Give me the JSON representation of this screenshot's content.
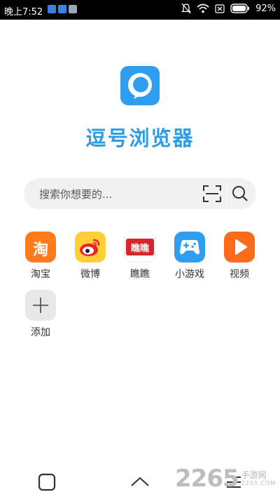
{
  "status_bar": {
    "time": "晚上7:52",
    "battery": "92%",
    "icons": [
      "shield-notification-icon",
      "sync-notification-icon",
      "storage-notification-icon",
      "bell-muted-icon",
      "wifi-icon",
      "sim-card-icon",
      "battery-icon"
    ]
  },
  "app": {
    "title": "逗号浏览器",
    "accent_color": "#2b9ee6"
  },
  "search": {
    "placeholder": "搜索你想要的..."
  },
  "shortcuts": [
    {
      "label": "淘宝",
      "icon": "taobao-icon",
      "color": "#ff7a1a",
      "glyph": "淘"
    },
    {
      "label": "微博",
      "icon": "weibo-icon",
      "color": "#ffcf3a"
    },
    {
      "label": "瞧瞧",
      "icon": "qiaoqiao-icon",
      "color": "#d7262b",
      "glyph": "瞧瞧"
    },
    {
      "label": "小游戏",
      "icon": "gamepad-icon",
      "color": "#2f9ef0"
    },
    {
      "label": "视频",
      "icon": "play-icon",
      "color": "#ff6a1a"
    },
    {
      "label": "添加",
      "icon": "plus-icon",
      "color": "#e8e8e8"
    }
  ],
  "watermark": {
    "number": "2265",
    "line1": "手游网",
    "line2": "2265.COM"
  }
}
